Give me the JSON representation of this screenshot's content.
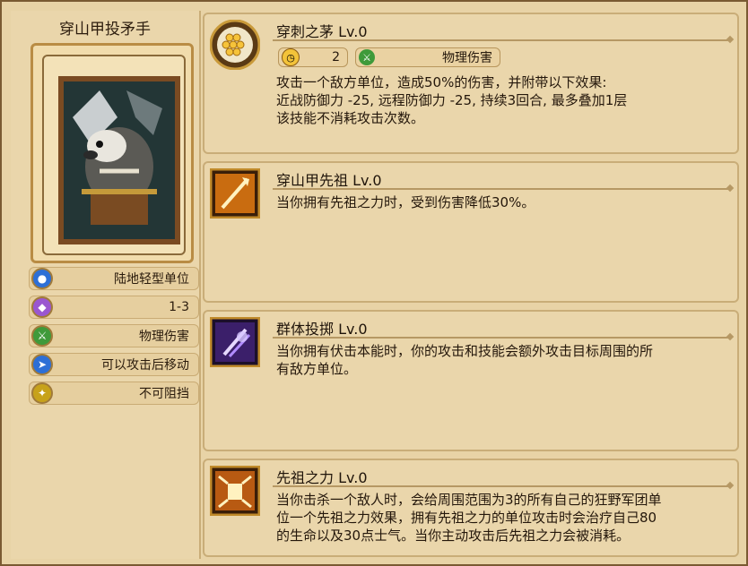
{
  "unit": {
    "name": "穿山甲投矛手",
    "tags": [
      {
        "icon": "person-icon",
        "color": "#2d6fd6",
        "label": "陆地轻型单位"
      },
      {
        "icon": "range-target-icon",
        "color": "#9a57d0",
        "label": "1-3"
      },
      {
        "icon": "sword-icon",
        "color": "#3f9a3a",
        "label": "物理伤害"
      },
      {
        "icon": "boot-move-icon",
        "color": "#2d6fd6",
        "label": "可以攻击后移动"
      },
      {
        "icon": "unstoppable-icon",
        "color": "#c7a21a",
        "label": "不可阻挡"
      }
    ]
  },
  "skills": [
    {
      "name": "穿刺之茅 Lv.0",
      "icon": "honeycomb-spear-icon",
      "cooldown": "2",
      "damage_type": "物理伤害",
      "description": "攻击一个敌方单位，造成50%的伤害，并附带以下效果:\n近战防御力 -25, 远程防御力 -25, 持续3回合, 最多叠加1层\n该技能不消耗攻击次数。"
    },
    {
      "name": "穿山甲先祖 Lv.0",
      "icon": "ancestor-spear-icon",
      "description": "当你拥有先祖之力时，受到伤害降低30%。"
    },
    {
      "name": "群体投掷 Lv.0",
      "icon": "mass-throw-icon",
      "description": "当你拥有伏击本能时，你的攻击和技能会额外攻击目标周围的所\n有敌方单位。"
    },
    {
      "name": "先祖之力 Lv.0",
      "icon": "ancestral-power-icon",
      "description": "当你击杀一个敌人时，会给周围范围为3的所有自己的狂野军团单\n位一个先祖之力效果，拥有先祖之力的单位攻击时会治疗自己80\n的生命以及30点士气。当你主动攻击后先祖之力会被消耗。"
    }
  ]
}
